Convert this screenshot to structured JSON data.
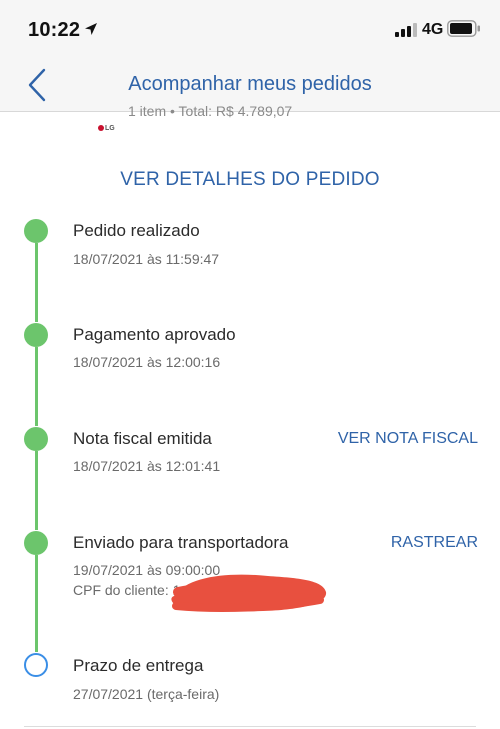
{
  "status_bar": {
    "time": "10:22",
    "network": "4G",
    "icons": [
      "location-arrow-icon",
      "signal-icon",
      "battery-icon"
    ]
  },
  "nav": {
    "title": "Acompanhar meus pedidos",
    "back_icon": "chevron-left-icon"
  },
  "order_summary": {
    "text": "1 item • Total: R$ 4.789,07",
    "brand": "LG"
  },
  "details_link": "VER DETALHES DO PEDIDO",
  "timeline": [
    {
      "title": "Pedido realizado",
      "date": "18/07/2021 às 11:59:47",
      "status": "done"
    },
    {
      "title": "Pagamento aprovado",
      "date": "18/07/2021 às 12:00:16",
      "status": "done"
    },
    {
      "title": "Nota fiscal emitida",
      "date": "18/07/2021 às 12:01:41",
      "status": "done",
      "action": "VER NOTA FISCAL"
    },
    {
      "title": "Enviado para transportadora",
      "date": "19/07/2021 às 09:00:00",
      "status": "done",
      "action": "RASTREAR",
      "extra": "CPF do cliente: 1"
    },
    {
      "title": "Prazo de entrega",
      "date": "27/07/2021 (terça-feira)",
      "status": "pending"
    }
  ],
  "colors": {
    "accent": "#2f63a8",
    "done": "#6cc56c",
    "pending": "#3a8ee6",
    "redaction": "#e8503f"
  }
}
